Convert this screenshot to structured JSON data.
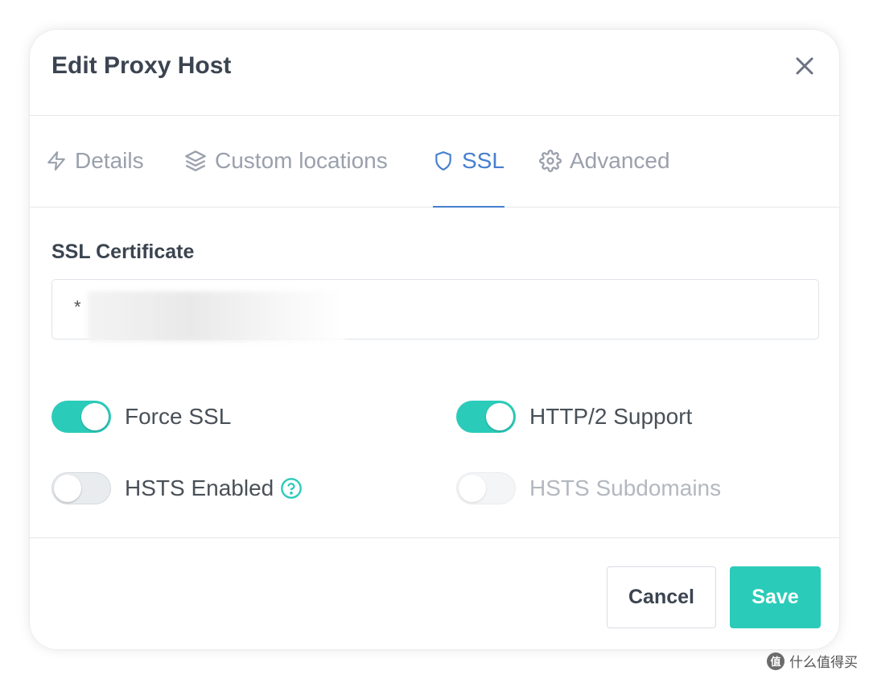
{
  "modal": {
    "title": "Edit Proxy Host",
    "close_icon": "close-icon"
  },
  "tabs": [
    {
      "label": "Details",
      "icon": "lightning-icon",
      "active": false
    },
    {
      "label": "Custom locations",
      "icon": "layers-icon",
      "active": false
    },
    {
      "label": "SSL",
      "icon": "shield-icon",
      "active": true
    },
    {
      "label": "Advanced",
      "icon": "gear-icon",
      "active": false
    }
  ],
  "ssl": {
    "certificate_label": "SSL Certificate",
    "certificate_value": "*",
    "switches": {
      "force_ssl": {
        "label": "Force SSL",
        "on": true
      },
      "http2_support": {
        "label": "HTTP/2 Support",
        "on": true
      },
      "hsts_enabled": {
        "label": "HSTS Enabled",
        "on": false
      },
      "hsts_subdomains": {
        "label": "HSTS Subdomains",
        "on": false,
        "disabled": true
      }
    }
  },
  "footer": {
    "cancel_label": "Cancel",
    "save_label": "Save"
  },
  "watermark": {
    "icon_text": "值",
    "text": "什么值得买"
  },
  "colors": {
    "accent_teal": "#2bcbba",
    "active_tab_blue": "#467fcf",
    "text_dark": "#3b4450",
    "text_muted": "#9aa0ac"
  }
}
